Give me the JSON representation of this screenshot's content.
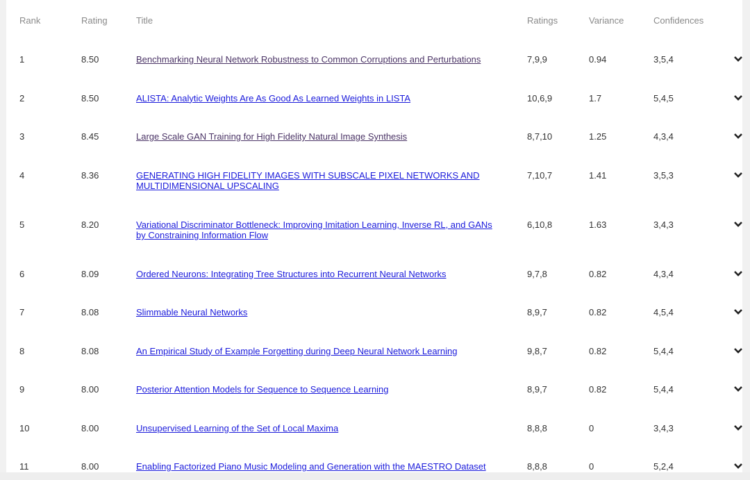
{
  "headers": {
    "rank": "Rank",
    "rating": "Rating",
    "title": "Title",
    "ratings": "Ratings",
    "variance": "Variance",
    "confidences": "Confidences"
  },
  "rows": [
    {
      "rank": "1",
      "rating": "8.50",
      "title": "Benchmarking Neural Network Robustness to Common Corruptions and Perturbations",
      "ratings": "7,9,9",
      "variance": "0.94",
      "confidences": "3,5,4",
      "visited": true
    },
    {
      "rank": "2",
      "rating": "8.50",
      "title": "ALISTA: Analytic Weights Are As Good As Learned Weights in LISTA",
      "ratings": "10,6,9",
      "variance": "1.7",
      "confidences": "5,4,5",
      "visited": false
    },
    {
      "rank": "3",
      "rating": "8.45",
      "title": "Large Scale GAN Training for High Fidelity Natural Image Synthesis",
      "ratings": "8,7,10",
      "variance": "1.25",
      "confidences": "4,3,4",
      "visited": true
    },
    {
      "rank": "4",
      "rating": "8.36",
      "title": "GENERATING HIGH FIDELITY IMAGES WITH SUBSCALE PIXEL NETWORKS AND MULTIDIMENSIONAL UPSCALING",
      "ratings": "7,10,7",
      "variance": "1.41",
      "confidences": "3,5,3",
      "visited": false
    },
    {
      "rank": "5",
      "rating": "8.20",
      "title": "Variational Discriminator Bottleneck: Improving Imitation Learning, Inverse RL, and GANs by Constraining Information Flow",
      "ratings": "6,10,8",
      "variance": "1.63",
      "confidences": "3,4,3",
      "visited": false
    },
    {
      "rank": "6",
      "rating": "8.09",
      "title": "Ordered Neurons: Integrating Tree Structures into Recurrent Neural Networks",
      "ratings": "9,7,8",
      "variance": "0.82",
      "confidences": "4,3,4",
      "visited": false
    },
    {
      "rank": "7",
      "rating": "8.08",
      "title": "Slimmable Neural Networks",
      "ratings": "8,9,7",
      "variance": "0.82",
      "confidences": "4,5,4",
      "visited": false
    },
    {
      "rank": "8",
      "rating": "8.08",
      "title": "An Empirical Study of Example Forgetting during Deep Neural Network Learning",
      "ratings": "9,8,7",
      "variance": "0.82",
      "confidences": "5,4,4",
      "visited": false
    },
    {
      "rank": "9",
      "rating": "8.00",
      "title": "Posterior Attention Models for Sequence to Sequence Learning",
      "ratings": "8,9,7",
      "variance": "0.82",
      "confidences": "5,4,4",
      "visited": false
    },
    {
      "rank": "10",
      "rating": "8.00",
      "title": "Unsupervised Learning of the Set of Local Maxima",
      "ratings": "8,8,8",
      "variance": "0",
      "confidences": "3,4,3",
      "visited": false
    },
    {
      "rank": "11",
      "rating": "8.00",
      "title": "Enabling Factorized Piano Music Modeling and Generation with the MAESTRO Dataset",
      "ratings": "8,8,8",
      "variance": "0",
      "confidences": "5,2,4",
      "visited": false
    }
  ]
}
